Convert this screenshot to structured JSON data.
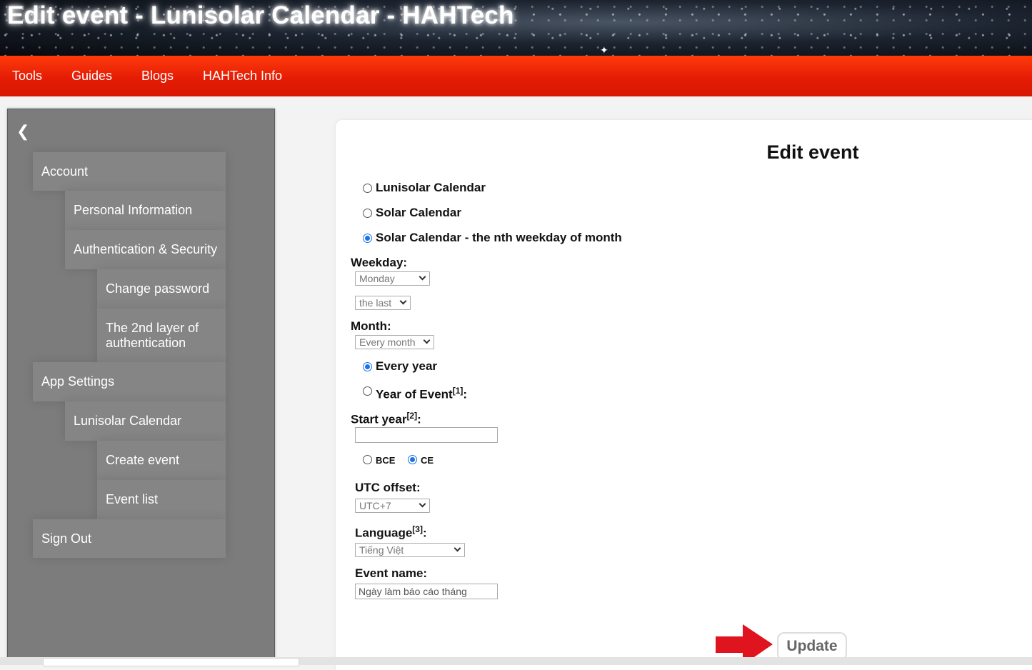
{
  "header": {
    "title": "Edit event - Lunisolar Calendar - HAHTech"
  },
  "nav": {
    "items": [
      "Tools",
      "Guides",
      "Blogs",
      "HAHTech Info"
    ]
  },
  "sidebar": {
    "back_icon": "chevron-left-icon",
    "items": {
      "account": "Account",
      "personal_information": "Personal Information",
      "auth_security": "Authentication & Security",
      "change_password": "Change password",
      "second_layer_line1": "The 2nd layer of",
      "second_layer_line2": "authentication",
      "app_settings": "App Settings",
      "lunisolar_calendar": "Lunisolar Calendar",
      "create_event": "Create event",
      "event_list": "Event list",
      "sign_out": "Sign Out"
    }
  },
  "form": {
    "title": "Edit event",
    "calendar_type": {
      "options": [
        "Lunisolar Calendar",
        "Solar Calendar",
        "Solar Calendar - the nth weekday of month"
      ],
      "selected": "Solar Calendar - the nth weekday of month"
    },
    "weekday_label": "Weekday:",
    "weekday_value": "Monday",
    "nth_value": "the last",
    "month_label": "Month:",
    "month_value": "Every month",
    "year_mode": {
      "every_year": "Every year",
      "year_of_event": "Year of Event",
      "year_of_event_ref": "[1]",
      "colon": ":",
      "selected": "Every year"
    },
    "start_year_label": "Start year",
    "start_year_ref": "[2]",
    "start_year_colon": ":",
    "start_year_value": "",
    "era": {
      "bce": "BCE",
      "ce": "CE",
      "selected": "CE"
    },
    "utc_label": "UTC offset:",
    "utc_value": "UTC+7",
    "language_label": "Language",
    "language_ref": "[3]",
    "language_colon": ":",
    "language_value": "Tiếng Việt",
    "event_name_label": "Event name:",
    "event_name_value": "Ngày làm báo cáo tháng",
    "update_label": "Update"
  },
  "colors": {
    "nav_red": "#e51c05",
    "sidebar_gray": "#7c7c7c",
    "radio_blue": "#1a73e8",
    "arrow_red": "#e0141e"
  }
}
